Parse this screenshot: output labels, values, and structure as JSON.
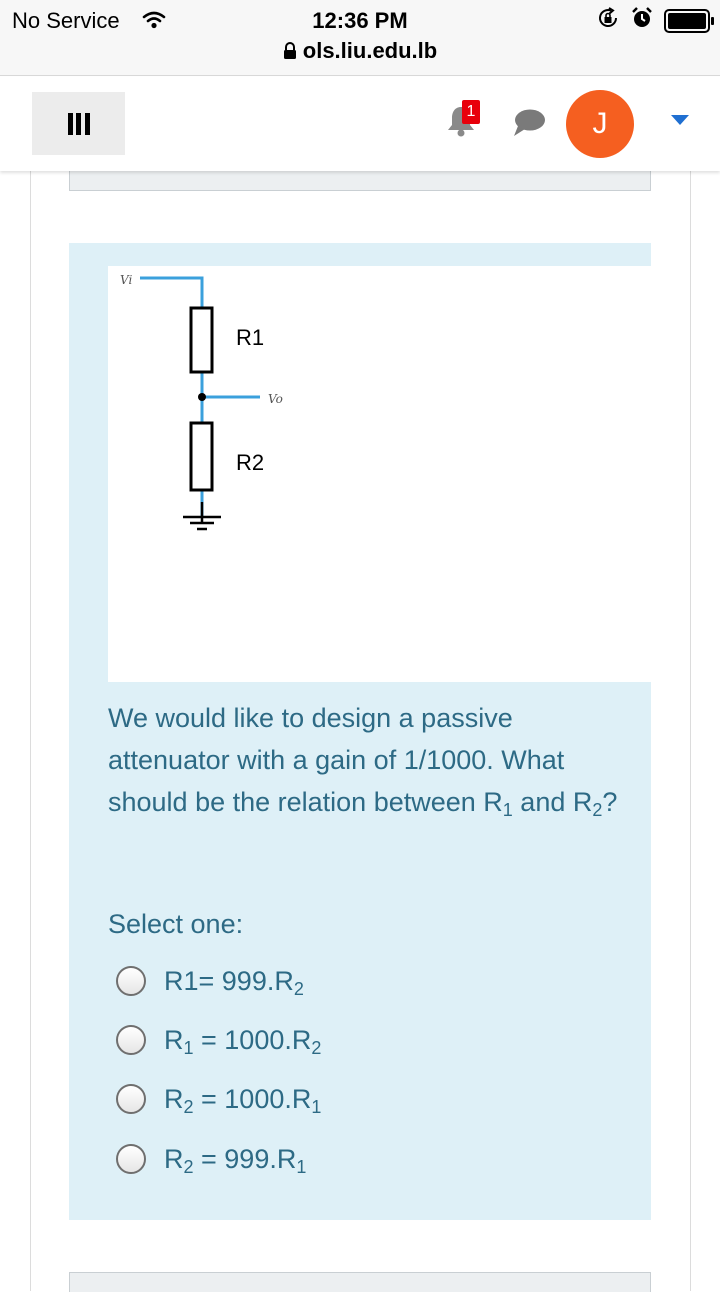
{
  "status_bar": {
    "carrier": "No Service",
    "time": "12:36 PM",
    "url": "ols.liu.edu.lb"
  },
  "navbar": {
    "notification_count": "1",
    "avatar_initial": "J",
    "colors": {
      "avatar": "#f55f20",
      "badge": "#e8000b",
      "caret": "#1f6fd1"
    }
  },
  "circuit": {
    "input_label": "Vi",
    "output_label": "Vo",
    "r1_label": "R1",
    "r2_label": "R2"
  },
  "question": {
    "text_part1": "We would like to design a passive attenuator with a gain of 1/1000. What should be the relation between R",
    "sub1": "1",
    "text_part2": " and R",
    "sub2": "2",
    "text_part3": "?",
    "select_label": "Select one:",
    "options": [
      {
        "pre": "R1= 999.R",
        "sub_a": "",
        "mid": "",
        "sub_b": "2"
      },
      {
        "pre": "R",
        "sub_a": "1",
        "mid": " = 1000.R",
        "sub_b": "2"
      },
      {
        "pre": "R",
        "sub_a": "2",
        "mid": " = 1000.R",
        "sub_b": "1"
      },
      {
        "pre": "R",
        "sub_a": "2",
        "mid": " = 999.R",
        "sub_b": "1"
      }
    ]
  }
}
